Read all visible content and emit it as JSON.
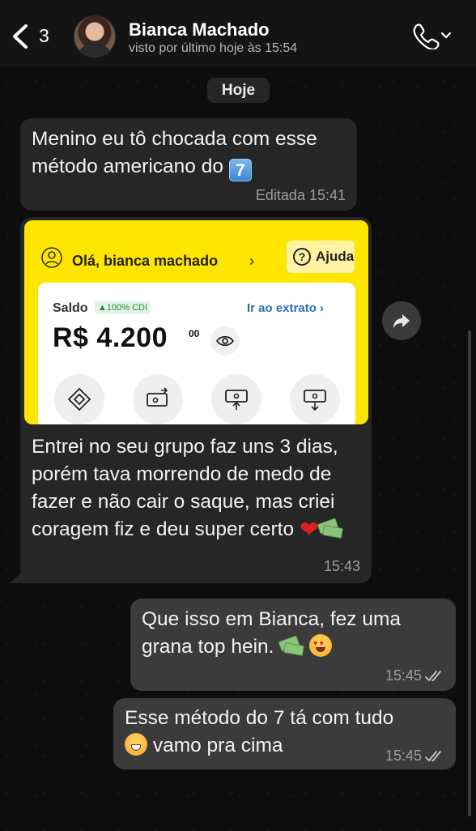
{
  "header": {
    "back_count": "3",
    "contact_name": "Bianca Machado",
    "last_seen": "visto por último hoje às 15:54",
    "avatar_icon": "avatar-photo",
    "call_icon": "phone-icon"
  },
  "date_separator": "Hoje",
  "messages": [
    {
      "direction": "incoming",
      "text": "Menino eu tô chocada com esse método americano do",
      "emoji": "7",
      "meta": "Editada 15:41"
    },
    {
      "direction": "incoming",
      "screenshot": {
        "greeting": "Olá, bianca machado",
        "help": "Ajuda",
        "saldo_label": "Saldo",
        "cdi_badge": "▲100% CDI",
        "extrato_link": "Ir ao extrato",
        "balance": "R$ 4.200",
        "cents": "00",
        "brand_color": "#ffe600"
      },
      "text": "Entrei no seu grupo faz uns 3 dias, porém tava morrendo de medo de fazer e não cair o saque, mas criei coragem fiz e deu super certo",
      "meta": "15:43"
    },
    {
      "direction": "outgoing",
      "text": "Que isso em Bianca, fez uma grana top hein.",
      "meta": "15:45"
    },
    {
      "direction": "outgoing",
      "text_after_emoji": "vamo pra cima",
      "text": "Esse método do 7 tá com tudo",
      "meta": "15:45"
    }
  ],
  "colors": {
    "incoming_bubble": "#262626",
    "outgoing_bubble": "#3b3b3b",
    "background": "#0d0d0d"
  }
}
